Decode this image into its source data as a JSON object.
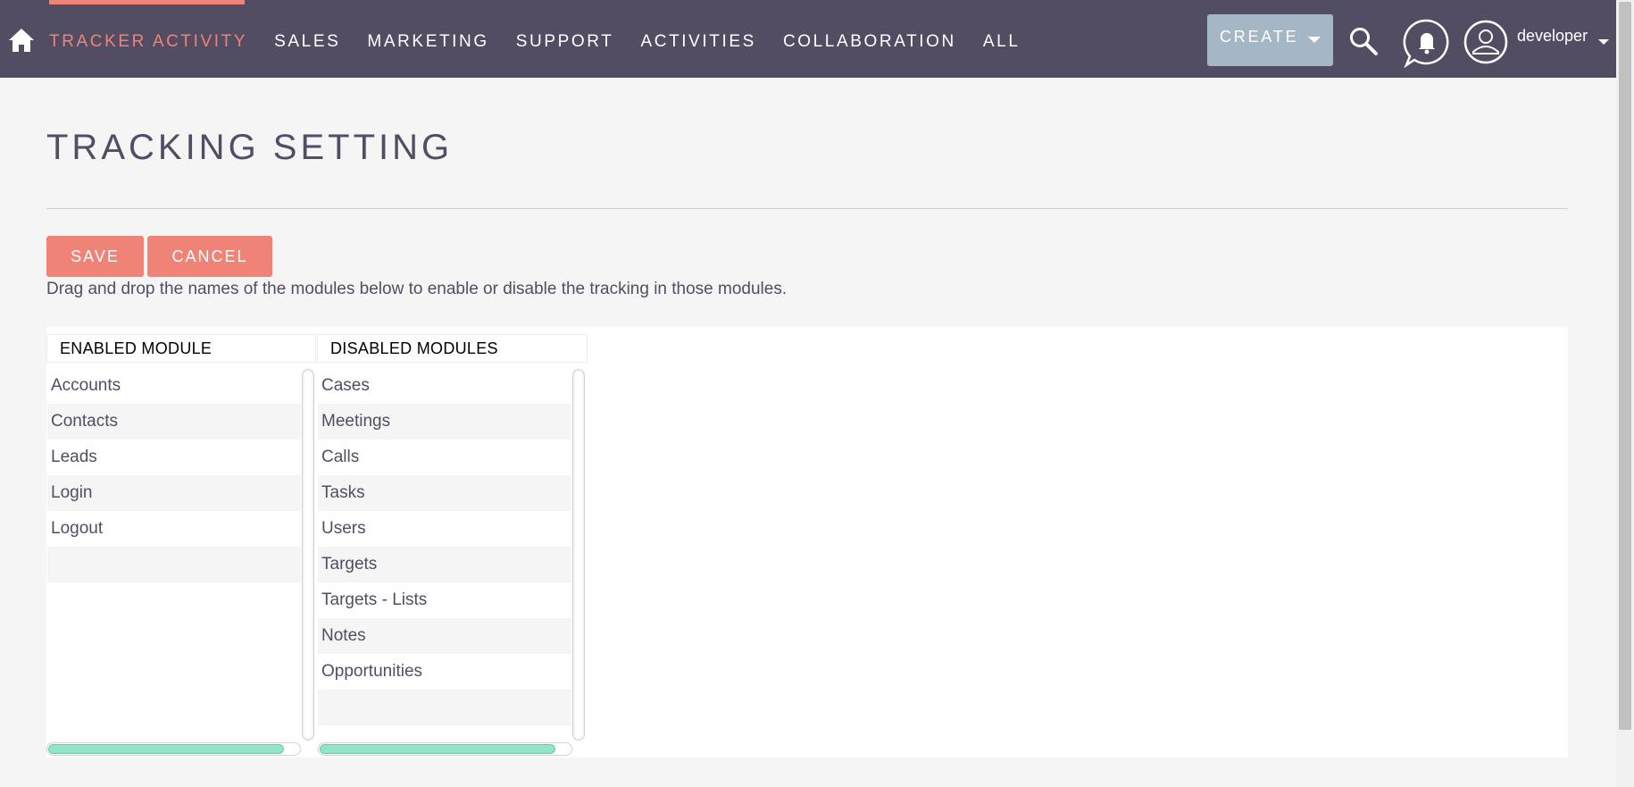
{
  "nav": {
    "items": [
      {
        "label": "TRACKER ACTIVITY",
        "active": true
      },
      {
        "label": "SALES",
        "active": false
      },
      {
        "label": "MARKETING",
        "active": false
      },
      {
        "label": "SUPPORT",
        "active": false
      },
      {
        "label": "ACTIVITIES",
        "active": false
      },
      {
        "label": "COLLABORATION",
        "active": false
      },
      {
        "label": "ALL",
        "active": false
      }
    ],
    "create_label": "CREATE",
    "user_name": "developer",
    "icons": [
      "home-icon",
      "search-icon",
      "bell-icon",
      "user-icon",
      "chevron-down-icon"
    ]
  },
  "page": {
    "title": "TRACKING SETTING",
    "save_label": "SAVE",
    "cancel_label": "CANCEL",
    "instructions": "Drag and drop the names of the modules below to enable or disable the tracking in those modules."
  },
  "enabled": {
    "header": "ENABLED MODULE",
    "items": [
      "Accounts",
      "Contacts",
      "Leads",
      "Login",
      "Logout"
    ]
  },
  "disabled": {
    "header": "DISABLED MODULES",
    "items": [
      "Cases",
      "Meetings",
      "Calls",
      "Tasks",
      "Users",
      "Targets",
      "Targets - Lists",
      "Notes",
      "Opportunities"
    ]
  },
  "colors": {
    "nav_bg": "#534d64",
    "accent": "#f08377",
    "create_bg": "#a5b6c6",
    "scroll_thumb": "#8fe4cb"
  }
}
